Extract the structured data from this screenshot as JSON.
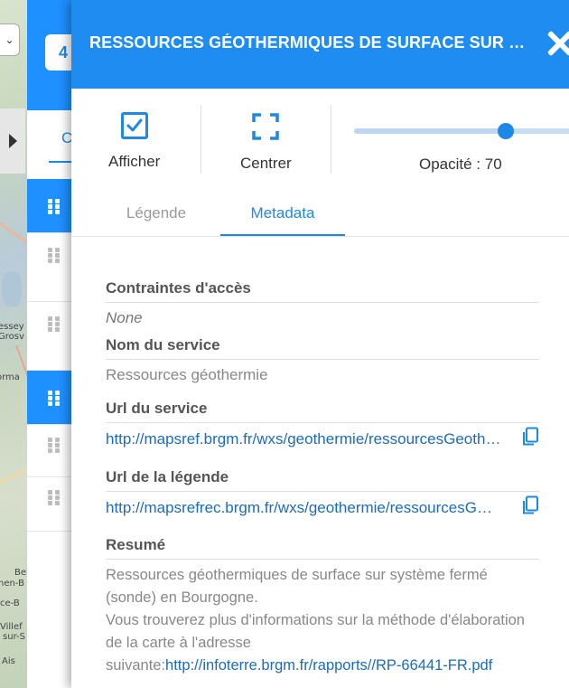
{
  "map": {
    "labels": [
      "essey",
      "Grosv",
      "orma",
      "Bel",
      "nen-B",
      "ce-B",
      "Villef",
      "sur-S",
      "Ais"
    ]
  },
  "layer_list": {
    "badge": "4",
    "tab_stub": "C"
  },
  "panel": {
    "title": "RESSOURCES GÉOTHERMIQUES DE SURFACE SUR SYSTÈME FERMÉ (SONDE) EN BOURGOGNE",
    "controls": {
      "show_label": "Afficher",
      "show_checked": true,
      "center_label": "Centrer",
      "opacity_label": "Opacité : 70",
      "opacity_value": 70
    },
    "tabs": {
      "legend": "Légende",
      "metadata": "Metadata",
      "active": "metadata"
    },
    "metadata": {
      "access_label": "Contraintes d'accès",
      "access_value": "None",
      "service_name_label": "Nom du service",
      "service_name_value": "Ressources géothermie",
      "service_url_label": "Url du service",
      "service_url_value": "http://mapsref.brgm.fr/wxs/geothermie/ressourcesGeothermie",
      "legend_url_label": "Url de la légende",
      "legend_url_value": "http://mapsrefrec.brgm.fr/wxs/geothermie/ressourcesGeothermie",
      "summary_label": "Resumé",
      "summary_text": "Ressources géothermiques de surface sur système fermé (sonde) en Bourgogne.",
      "summary_more": "Vous trouverez plus d'informations sur la méthode d'élaboration de la carte à l'adresse suivante:",
      "summary_link": "http://infoterre.brgm.fr/rapports//RP-66441-FR.pdf"
    }
  },
  "colors": {
    "accent": "#1e8cf0",
    "link": "#1b6bbf"
  }
}
